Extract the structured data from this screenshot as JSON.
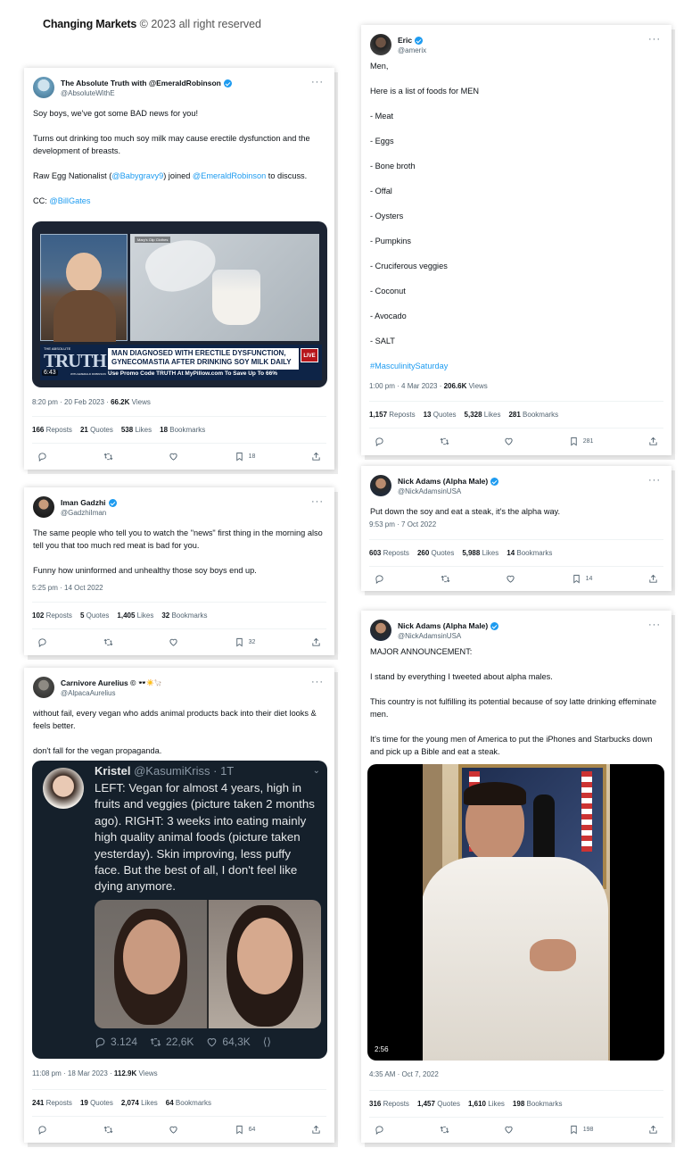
{
  "header": {
    "brand": "Changing Markets",
    "copyright": "© 2023 all right reserved"
  },
  "tweets": {
    "t1": {
      "name": "The Absolute Truth with @EmeraldRobinson",
      "handle": "@AbsoluteWithE",
      "line1": "Soy boys, we've got some BAD news for you!",
      "line2": "Turns out drinking too much soy milk may cause erectile dysfunction and the development of breasts.",
      "line3a": "Raw Egg Nationalist (",
      "line3b": "@Babygravy9",
      "line3c": ") joined ",
      "line3d": "@EmeraldRobinson",
      "line3e": " to discuss.",
      "line4a": "CC: ",
      "line4b": "@BillGates",
      "video": {
        "inset_label": "Mary's Clip Clothes",
        "logo_small": "THE ABSOLUTE",
        "logo_big": "TRUTH",
        "logo_sub": "WITH EMERALD ROBINSON",
        "headline1": "MAN DIAGNOSED WITH ERECTILE DYSFUNCTION,",
        "headline2": "GYNECOMASTIA AFTER DRINKING SOY MILK DAILY",
        "ticker": "Use Promo Code TRUTH At MyPillow.com To Save Up To 66%",
        "duration": "6:43",
        "badge": "LIVE"
      },
      "time": "8:20 pm · 20 Feb 2023 · ",
      "views": "66.2K",
      "views_label": " Views",
      "reposts": "166",
      "quotes": "21",
      "likes": "538",
      "bookmarks": "18",
      "bookmark_count": "18"
    },
    "t2": {
      "name": "Iman Gadzhi",
      "handle": "@GadzhiIman",
      "line1": "The same people who tell you to watch the \"news\" first thing in the morning also tell you that too much red meat is bad for you.",
      "line2": "Funny how uninformed and unhealthy those soy boys end up.",
      "time": "5:25 pm · 14 Oct 2022",
      "reposts": "102",
      "quotes": "5",
      "likes": "1,405",
      "bookmarks": "32",
      "bookmark_count": "32"
    },
    "t3": {
      "name": "Carnivore Aurelius ©",
      "emoji": "🕶️☀️🦙",
      "handle": "@AlpacaAurelius",
      "line1": "without fail, every vegan who adds animal products back into their diet looks & feels better.",
      "line2": "don't fall for the vegan propaganda.",
      "inner": {
        "name": "Kristel",
        "handle": "@KasumiKriss · 1T",
        "text": "LEFT: Vegan for almost 4 years, high in fruits and veggies (picture taken 2 months ago). RIGHT: 3 weeks into eating mainly high quality animal foods (picture taken yesterday). Skin improving, less puffy face. But the best of all, I don't feel like dying anymore.",
        "replies": "3.124",
        "retweets": "22,6K",
        "likes": "64,3K"
      },
      "time": "11:08 pm · 18 Mar 2023 · ",
      "views": "112.9K",
      "views_label": " Views",
      "reposts": "241",
      "quotes": "19",
      "likes": "2,074",
      "bookmarks": "64",
      "bookmark_count": "64"
    },
    "t4": {
      "name": "Eric",
      "handle": "@amerix",
      "lines": [
        "Men,",
        "Here is a list of foods for MEN",
        "- Meat",
        "- Eggs",
        "- Bone broth",
        "- Offal",
        "- Oysters",
        "- Pumpkins",
        "- Cruciferous veggies",
        "- Coconut",
        "- Avocado",
        "- SALT"
      ],
      "hashtag": "#MasculinitySaturday",
      "time": "1:00 pm · 4 Mar 2023 · ",
      "views": "206.6K",
      "views_label": " Views",
      "reposts": "1,157",
      "quotes": "13",
      "likes": "5,328",
      "bookmarks": "281",
      "bookmark_count": "281"
    },
    "t5": {
      "name": "Nick Adams (Alpha Male)",
      "handle": "@NickAdamsinUSA",
      "line1": "Put down the soy and eat a steak, it's the alpha way.",
      "time": "9:53 pm · 7 Oct 2022",
      "reposts": "603",
      "quotes": "260",
      "likes": "5,988",
      "bookmarks": "14",
      "bookmark_count": "14"
    },
    "t6": {
      "name": "Nick Adams (Alpha Male)",
      "handle": "@NickAdamsinUSA",
      "line1": "MAJOR ANNOUNCEMENT:",
      "line2": "I stand by everything I tweeted about alpha males.",
      "line3": "This country is not fulfilling its potential because of soy latte drinking effeminate men.",
      "line4": "It's time for the young men of America to put the iPhones and Starbucks down and pick up a Bible and eat a steak.",
      "video_duration": "2:56",
      "time": "4:35 AM · Oct 7, 2022",
      "reposts": "316",
      "quotes": "1,457",
      "likes": "1,610",
      "bookmarks": "198",
      "bookmark_count": "198"
    }
  },
  "labels": {
    "reposts": " Reposts",
    "quotes": " Quotes",
    "likes": " Likes",
    "bookmarks": " Bookmarks"
  },
  "icons": [
    "reply-icon",
    "repost-icon",
    "like-icon",
    "bookmark-icon",
    "share-icon",
    "more-icon",
    "verified-icon"
  ],
  "colors": {
    "link": "#1d9bf0",
    "verified": "#1d9bf0",
    "text": "#0f1419",
    "muted": "#536471"
  }
}
